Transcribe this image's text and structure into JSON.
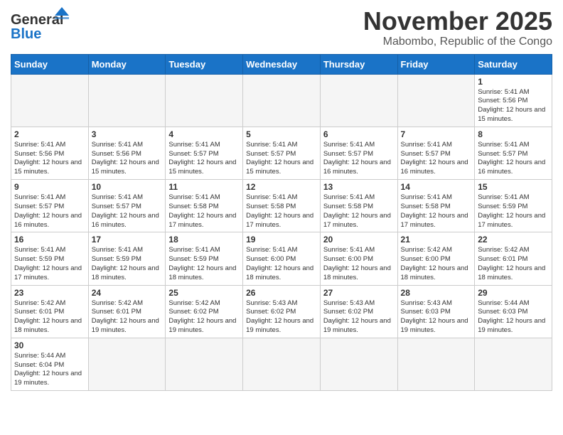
{
  "header": {
    "logo_general": "General",
    "logo_blue": "Blue",
    "month": "November 2025",
    "location": "Mabombo, Republic of the Congo"
  },
  "weekdays": [
    "Sunday",
    "Monday",
    "Tuesday",
    "Wednesday",
    "Thursday",
    "Friday",
    "Saturday"
  ],
  "weeks": [
    [
      {
        "day": "",
        "info": ""
      },
      {
        "day": "",
        "info": ""
      },
      {
        "day": "",
        "info": ""
      },
      {
        "day": "",
        "info": ""
      },
      {
        "day": "",
        "info": ""
      },
      {
        "day": "",
        "info": ""
      },
      {
        "day": "1",
        "info": "Sunrise: 5:41 AM\nSunset: 5:56 PM\nDaylight: 12 hours and 15 minutes."
      }
    ],
    [
      {
        "day": "2",
        "info": "Sunrise: 5:41 AM\nSunset: 5:56 PM\nDaylight: 12 hours and 15 minutes."
      },
      {
        "day": "3",
        "info": "Sunrise: 5:41 AM\nSunset: 5:56 PM\nDaylight: 12 hours and 15 minutes."
      },
      {
        "day": "4",
        "info": "Sunrise: 5:41 AM\nSunset: 5:57 PM\nDaylight: 12 hours and 15 minutes."
      },
      {
        "day": "5",
        "info": "Sunrise: 5:41 AM\nSunset: 5:57 PM\nDaylight: 12 hours and 15 minutes."
      },
      {
        "day": "6",
        "info": "Sunrise: 5:41 AM\nSunset: 5:57 PM\nDaylight: 12 hours and 16 minutes."
      },
      {
        "day": "7",
        "info": "Sunrise: 5:41 AM\nSunset: 5:57 PM\nDaylight: 12 hours and 16 minutes."
      },
      {
        "day": "8",
        "info": "Sunrise: 5:41 AM\nSunset: 5:57 PM\nDaylight: 12 hours and 16 minutes."
      }
    ],
    [
      {
        "day": "9",
        "info": "Sunrise: 5:41 AM\nSunset: 5:57 PM\nDaylight: 12 hours and 16 minutes."
      },
      {
        "day": "10",
        "info": "Sunrise: 5:41 AM\nSunset: 5:57 PM\nDaylight: 12 hours and 16 minutes."
      },
      {
        "day": "11",
        "info": "Sunrise: 5:41 AM\nSunset: 5:58 PM\nDaylight: 12 hours and 17 minutes."
      },
      {
        "day": "12",
        "info": "Sunrise: 5:41 AM\nSunset: 5:58 PM\nDaylight: 12 hours and 17 minutes."
      },
      {
        "day": "13",
        "info": "Sunrise: 5:41 AM\nSunset: 5:58 PM\nDaylight: 12 hours and 17 minutes."
      },
      {
        "day": "14",
        "info": "Sunrise: 5:41 AM\nSunset: 5:58 PM\nDaylight: 12 hours and 17 minutes."
      },
      {
        "day": "15",
        "info": "Sunrise: 5:41 AM\nSunset: 5:59 PM\nDaylight: 12 hours and 17 minutes."
      }
    ],
    [
      {
        "day": "16",
        "info": "Sunrise: 5:41 AM\nSunset: 5:59 PM\nDaylight: 12 hours and 17 minutes."
      },
      {
        "day": "17",
        "info": "Sunrise: 5:41 AM\nSunset: 5:59 PM\nDaylight: 12 hours and 18 minutes."
      },
      {
        "day": "18",
        "info": "Sunrise: 5:41 AM\nSunset: 5:59 PM\nDaylight: 12 hours and 18 minutes."
      },
      {
        "day": "19",
        "info": "Sunrise: 5:41 AM\nSunset: 6:00 PM\nDaylight: 12 hours and 18 minutes."
      },
      {
        "day": "20",
        "info": "Sunrise: 5:41 AM\nSunset: 6:00 PM\nDaylight: 12 hours and 18 minutes."
      },
      {
        "day": "21",
        "info": "Sunrise: 5:42 AM\nSunset: 6:00 PM\nDaylight: 12 hours and 18 minutes."
      },
      {
        "day": "22",
        "info": "Sunrise: 5:42 AM\nSunset: 6:01 PM\nDaylight: 12 hours and 18 minutes."
      }
    ],
    [
      {
        "day": "23",
        "info": "Sunrise: 5:42 AM\nSunset: 6:01 PM\nDaylight: 12 hours and 18 minutes."
      },
      {
        "day": "24",
        "info": "Sunrise: 5:42 AM\nSunset: 6:01 PM\nDaylight: 12 hours and 19 minutes."
      },
      {
        "day": "25",
        "info": "Sunrise: 5:42 AM\nSunset: 6:02 PM\nDaylight: 12 hours and 19 minutes."
      },
      {
        "day": "26",
        "info": "Sunrise: 5:43 AM\nSunset: 6:02 PM\nDaylight: 12 hours and 19 minutes."
      },
      {
        "day": "27",
        "info": "Sunrise: 5:43 AM\nSunset: 6:02 PM\nDaylight: 12 hours and 19 minutes."
      },
      {
        "day": "28",
        "info": "Sunrise: 5:43 AM\nSunset: 6:03 PM\nDaylight: 12 hours and 19 minutes."
      },
      {
        "day": "29",
        "info": "Sunrise: 5:44 AM\nSunset: 6:03 PM\nDaylight: 12 hours and 19 minutes."
      }
    ],
    [
      {
        "day": "30",
        "info": "Sunrise: 5:44 AM\nSunset: 6:04 PM\nDaylight: 12 hours and 19 minutes."
      },
      {
        "day": "",
        "info": ""
      },
      {
        "day": "",
        "info": ""
      },
      {
        "day": "",
        "info": ""
      },
      {
        "day": "",
        "info": ""
      },
      {
        "day": "",
        "info": ""
      },
      {
        "day": "",
        "info": ""
      }
    ]
  ]
}
